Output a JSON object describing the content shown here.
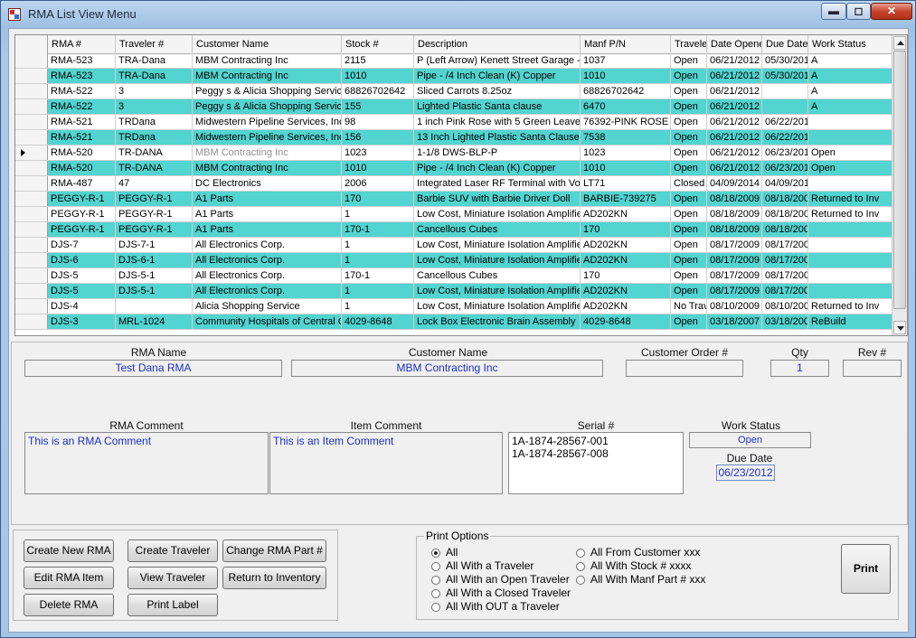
{
  "window": {
    "title": "RMA List View Menu",
    "min": "▬",
    "max": "◻",
    "close": "✕"
  },
  "grid": {
    "columns": [
      "RMA #",
      "Traveler #",
      "Customer Name",
      "Stock #",
      "Description",
      "Manf P/N",
      "Traveler",
      "Date Opene",
      "Due Date",
      "Work Status"
    ],
    "rows": [
      [
        "RMA-523",
        "TRA-Dana",
        "MBM Contracting  Inc",
        "2115",
        "P (Left Arrow) Kenett Street Garage - modif",
        "1037",
        "Open",
        "06/21/2012",
        "05/30/2012",
        "A"
      ],
      [
        "RMA-523",
        "TRA-Dana",
        "MBM Contracting  Inc",
        "1010",
        "Pipe - /4 Inch Clean (K) Copper",
        "1010",
        "Open",
        "06/21/2012",
        "05/30/2012",
        "A"
      ],
      [
        "RMA-522",
        "3",
        "Peggy s & Alicia Shopping Service",
        "68826702642",
        "Sliced Carrots 8.25oz",
        "68826702642",
        "Open",
        "06/21/2012",
        "",
        "A"
      ],
      [
        "RMA-522",
        "3",
        "Peggy s & Alicia Shopping Service",
        "155",
        "Lighted Plastic Santa clause",
        "6470",
        "Open",
        "06/21/2012",
        "",
        "A"
      ],
      [
        "RMA-521",
        "TRDana",
        "Midwestern Pipeline Services, Inc.",
        "98",
        "1 inch Pink Rose with 5 Green Leaves arou",
        "76392-PINK ROSE",
        "Open",
        "06/21/2012",
        "06/22/2012",
        ""
      ],
      [
        "RMA-521",
        "TRDana",
        "Midwestern Pipeline Services, Inc.",
        "156",
        "13 Inch Lighted Plastic Santa Clause",
        "7538",
        "Open",
        "06/21/2012",
        "06/22/2012",
        ""
      ],
      [
        "RMA-520",
        "TR-DANA",
        "MBM Contracting  Inc",
        "1023",
        "1-1/8 DWS-BLP-P",
        "1023",
        "Open",
        "06/21/2012",
        "06/23/2012",
        "Open"
      ],
      [
        "RMA-520",
        "TR-DANA",
        "MBM Contracting  Inc",
        "1010",
        "Pipe - /4 Inch Clean (K) Copper",
        "1010",
        "Open",
        "06/21/2012",
        "06/23/2012",
        "Open"
      ],
      [
        "RMA-487",
        "47",
        "DC Electronics",
        "2006",
        "Integrated Laser RF Terminal with Voice M",
        "LT71",
        "Closed",
        "04/09/2014",
        "04/09/2014",
        ""
      ],
      [
        "PEGGY-R-1",
        "PEGGY-R-1",
        "A1 Parts",
        "170",
        "Barbie SUV with Barbie Driver Doll",
        "BARBIE-739275",
        "Open",
        "08/18/2009",
        "08/18/2009",
        "Returned to Inv"
      ],
      [
        "PEGGY-R-1",
        "PEGGY-R-1",
        "A1 Parts",
        "1",
        "Low Cost, Miniature Isolation Amplifiers Po",
        "AD202KN",
        "Open",
        "08/18/2009",
        "08/18/2009",
        "Returned to Inv"
      ],
      [
        "PEGGY-R-1",
        "PEGGY-R-1",
        "A1 Parts",
        "170-1",
        "Cancellous Cubes",
        "170",
        "Open",
        "08/18/2009",
        "08/18/2009",
        ""
      ],
      [
        "DJS-7",
        "DJS-7-1",
        "All Electronics Corp.",
        "1",
        "Low Cost, Miniature Isolation Amplifiers Po",
        "AD202KN",
        "Open",
        "08/17/2009",
        "08/17/2009",
        ""
      ],
      [
        "DJS-6",
        "DJS-6-1",
        "All Electronics Corp.",
        "1",
        "Low Cost, Miniature Isolation Amplifiers Po",
        "AD202KN",
        "Open",
        "08/17/2009",
        "08/17/2009",
        ""
      ],
      [
        "DJS-5",
        "DJS-5-1",
        "All Electronics Corp.",
        "170-1",
        "Cancellous Cubes",
        "170",
        "Open",
        "08/17/2009",
        "08/17/2009",
        ""
      ],
      [
        "DJS-5",
        "DJS-5-1",
        "All Electronics Corp.",
        "1",
        "Low Cost, Miniature Isolation Amplifiers Po",
        "AD202KN",
        "Open",
        "08/17/2009",
        "08/17/2009",
        ""
      ],
      [
        "DJS-4",
        "",
        "Alicia Shopping Service",
        "1",
        "Low Cost, Miniature Isolation Amplifiers Po",
        "AD202KN",
        "No Trav",
        "08/10/2009",
        "08/10/2009",
        "Returned to Inv"
      ],
      [
        "DJS-3",
        "MRL-1024",
        "Community Hospitals of Central Califor",
        "4029-8648",
        "Lock Box Electronic Brain Assembly",
        "4029-8648",
        "Open",
        "03/18/2007",
        "03/18/2007",
        "ReBuild"
      ]
    ],
    "current_row_arrow": "▶",
    "alt_row_color": "#52d4d0"
  },
  "detail": {
    "rma_name_label": "RMA Name",
    "rma_name": "Test Dana RMA",
    "customer_name_label": "Customer Name",
    "customer_name": "MBM Contracting  Inc",
    "customer_order_label": "Customer Order #",
    "customer_order": "",
    "qty_label": "Qty",
    "qty": "1",
    "rev_label": "Rev #",
    "rev": "",
    "rma_comment_label": "RMA Comment",
    "rma_comment": "This is an RMA Comment",
    "item_comment_label": "Item  Comment",
    "item_comment": "This is an Item Comment",
    "serial_label": "Serial #",
    "serial_lines": [
      "1A-1874-28567-001",
      "1A-1874-28567-008"
    ],
    "work_status_label": "Work Status",
    "work_status": "Open",
    "due_date_label": "Due Date",
    "due_date": "06/23/2012"
  },
  "buttons": {
    "create_new_rma": "Create New RMA",
    "create_traveler": "Create Traveler",
    "change_rma_part": "Change RMA Part #",
    "edit_rma_item": "Edit RMA Item",
    "view_traveler": "View Traveler",
    "return_to_inventory": "Return to Inventory",
    "delete_rma": "Delete RMA",
    "print_label": "Print Label",
    "print": "Print"
  },
  "print_options": {
    "legend": "Print Options",
    "options": [
      "All",
      "All With a Traveler",
      "All With an Open Traveler",
      "All With a Closed Traveler",
      "All With OUT a Traveler",
      "All From Customer xxx",
      "All With Stock # xxxx",
      "All With Manf Part # xxx"
    ],
    "selected": "All"
  }
}
